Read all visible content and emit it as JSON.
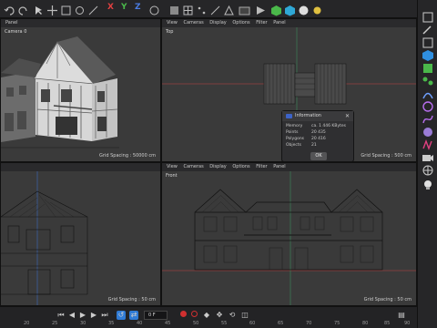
{
  "toolbar": {
    "axes": [
      "X",
      "Y",
      "Z"
    ],
    "icons": [
      "undo-icon",
      "redo-icon",
      "select-icon",
      "move-icon",
      "scale-icon",
      "rotate-icon",
      "cube-icon",
      "brush-icon",
      "render-icon"
    ]
  },
  "viewports": {
    "perspective": {
      "menu": [
        "Panel"
      ],
      "label": "Camera 0",
      "grid_spacing": "Grid Spacing : 50000 cm"
    },
    "top": {
      "menu": [
        "View",
        "Cameras",
        "Display",
        "Options",
        "Filter",
        "Panel"
      ],
      "label": "Top",
      "grid_spacing": "Grid Spacing : 500 cm"
    },
    "right": {
      "menu": [],
      "label": "",
      "grid_spacing": "Grid Spacing : 50 cm"
    },
    "front": {
      "menu": [
        "View",
        "Cameras",
        "Display",
        "Options",
        "Filter",
        "Panel"
      ],
      "label": "Front",
      "grid_spacing": "Grid Spacing : 50 cm"
    }
  },
  "info_dialog": {
    "title": "Information",
    "rows": [
      {
        "label": "Memory",
        "value": "ca. 1 446 KBytes"
      },
      {
        "label": "Points",
        "value": "20 435"
      },
      {
        "label": "Polygons",
        "value": "20 416"
      },
      {
        "label": "Objects",
        "value": "21"
      }
    ],
    "ok_label": "OK"
  },
  "timeline": {
    "frame_value": "0 F",
    "ticks": [
      "20",
      "25",
      "30",
      "35",
      "40",
      "45",
      "50",
      "55",
      "60",
      "65",
      "70",
      "75",
      "80",
      "85",
      "90"
    ]
  },
  "colors": {
    "accent": "#2f7bd6",
    "x_axis": "#e04040",
    "y_axis": "#4ab84a",
    "z_axis": "#4a7be0"
  }
}
